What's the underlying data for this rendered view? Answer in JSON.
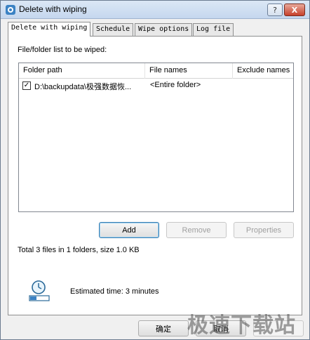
{
  "window": {
    "title": "Delete with wiping",
    "help_label": "?",
    "close_label": "X"
  },
  "tabs": [
    {
      "label": "Delete with wiping",
      "active": true
    },
    {
      "label": "Schedule",
      "active": false
    },
    {
      "label": "Wipe options",
      "active": false
    },
    {
      "label": "Log file",
      "active": false
    }
  ],
  "list": {
    "label": "File/folder list to be wiped:",
    "columns": [
      "Folder path",
      "File names",
      "Exclude names"
    ],
    "rows": [
      {
        "checked": true,
        "check_mark": "✓",
        "folder_path": "D:\\backupdata\\极强数据恢...",
        "file_names": "<Entire folder>",
        "exclude_names": ""
      }
    ]
  },
  "buttons": {
    "add": "Add",
    "remove": "Remove",
    "properties": "Properties",
    "ok": "确定",
    "cancel": "取消"
  },
  "summary": {
    "total": "Total 3 files in 1 folders, size 1.0 KB"
  },
  "estimate": {
    "text": "Estimated time: 3 minutes"
  },
  "watermark": {
    "text": "极速下载站"
  },
  "colors": {
    "titlebar": "#c5d7ee",
    "close": "#c7402b",
    "accent": "#3c7fb1"
  }
}
